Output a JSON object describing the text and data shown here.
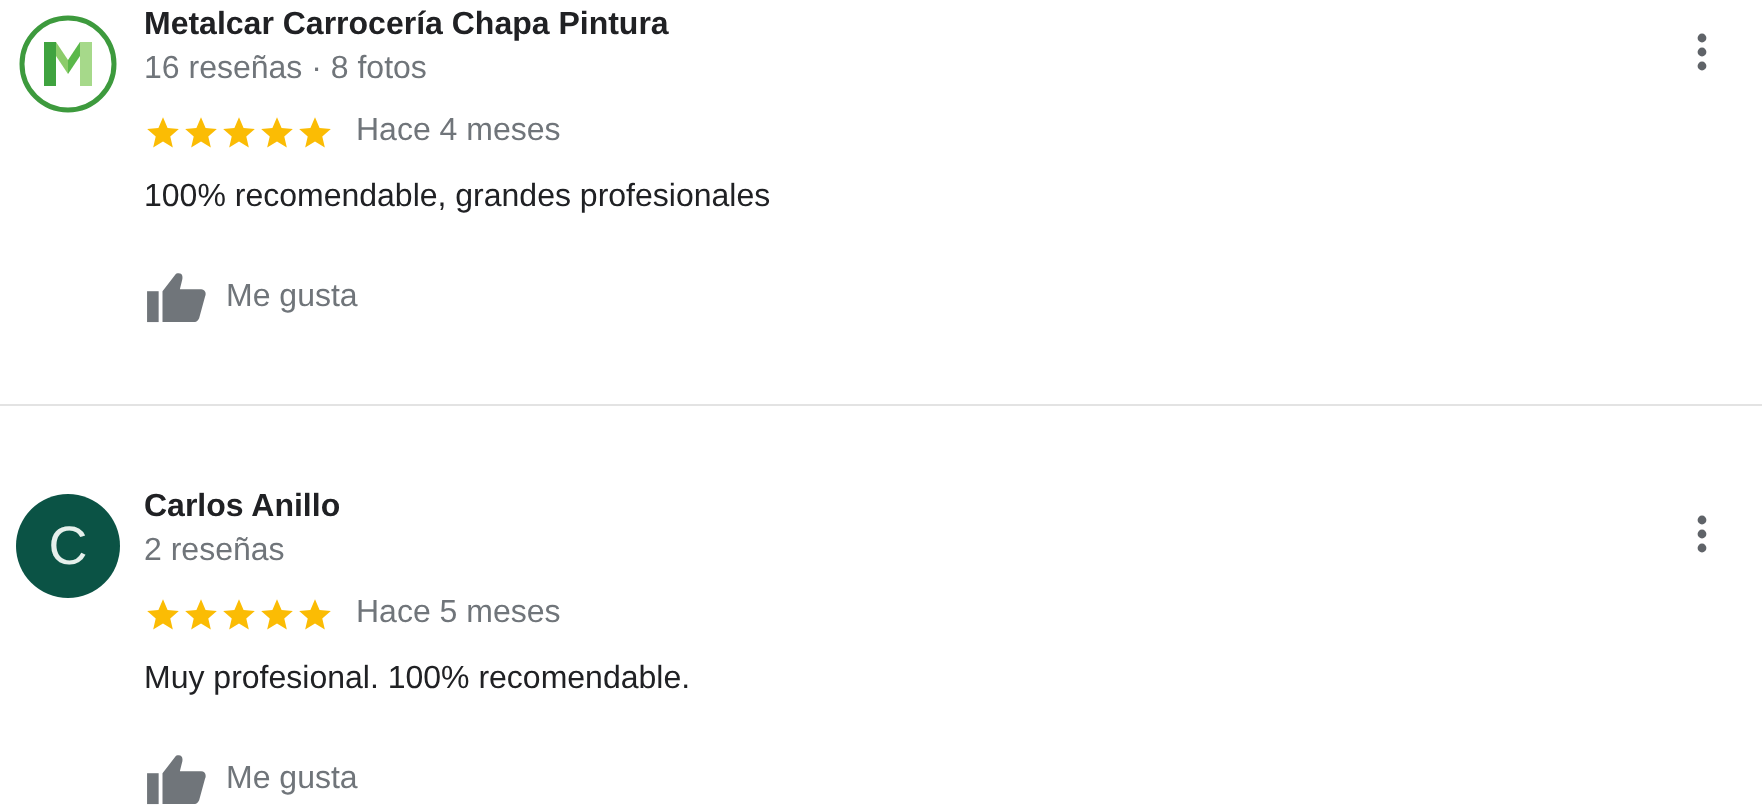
{
  "reviews": [
    {
      "avatar": {
        "kind": "logo"
      },
      "name": "Metalcar Carrocería Chapa Pintura",
      "meta": "16 reseñas · 8 fotos",
      "stars": 5,
      "time": "Hace 4 meses",
      "text": "100% recomendable, grandes profesionales",
      "like": "Me gusta"
    },
    {
      "avatar": {
        "kind": "letter",
        "initial": "C",
        "color": "#0b5345"
      },
      "name": "Carlos Anillo",
      "meta": "2 reseñas",
      "stars": 5,
      "time": "Hace 5 meses",
      "text": "Muy profesional. 100% recomendable.",
      "like": "Me gusta"
    }
  ]
}
